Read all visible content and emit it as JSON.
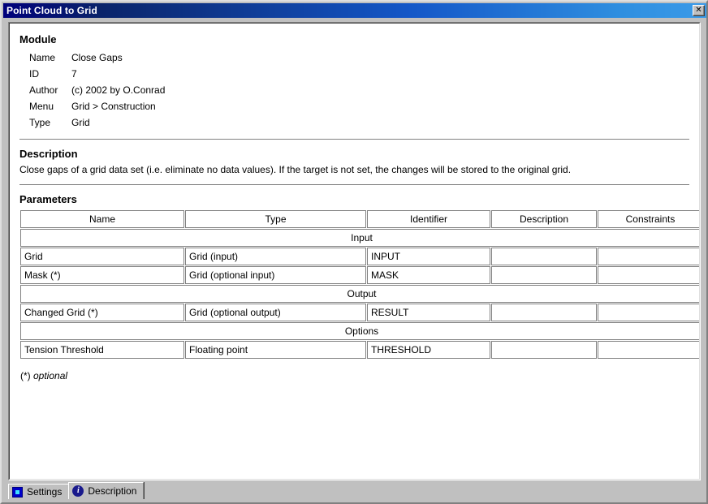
{
  "window": {
    "title": "Point Cloud to Grid",
    "close_label": "✕"
  },
  "module": {
    "heading": "Module",
    "fields": [
      {
        "label": "Name",
        "value": "Close Gaps"
      },
      {
        "label": "ID",
        "value": "7"
      },
      {
        "label": "Author",
        "value": "(c) 2002 by O.Conrad"
      },
      {
        "label": "Menu",
        "value": "Grid > Construction"
      },
      {
        "label": "Type",
        "value": "Grid"
      }
    ]
  },
  "description": {
    "heading": "Description",
    "text": "Close gaps of a grid data set (i.e. eliminate no data values). If the target is not set, the changes will be stored to the original grid."
  },
  "parameters": {
    "heading": "Parameters",
    "columns": [
      "Name",
      "Type",
      "Identifier",
      "Description",
      "Constraints"
    ],
    "sections": [
      {
        "label": "Input",
        "rows": [
          {
            "name": "Grid",
            "type": "Grid (input)",
            "identifier": "INPUT",
            "description": "",
            "constraints": ""
          },
          {
            "name": "Mask (*)",
            "type": "Grid (optional input)",
            "identifier": "MASK",
            "description": "",
            "constraints": ""
          }
        ]
      },
      {
        "label": "Output",
        "rows": [
          {
            "name": "Changed Grid (*)",
            "type": "Grid (optional output)",
            "identifier": "RESULT",
            "description": "",
            "constraints": ""
          }
        ]
      },
      {
        "label": "Options",
        "rows": [
          {
            "name": "Tension Threshold",
            "type": "Floating point",
            "identifier": "THRESHOLD",
            "description": "",
            "constraints": ""
          }
        ]
      }
    ],
    "footnote_marker": "(*) ",
    "footnote_text": "optional"
  },
  "tabs": [
    {
      "label": "Settings",
      "icon": "settings-square-icon",
      "active": false
    },
    {
      "label": "Description",
      "icon": "info-circle-icon",
      "active": true
    }
  ]
}
